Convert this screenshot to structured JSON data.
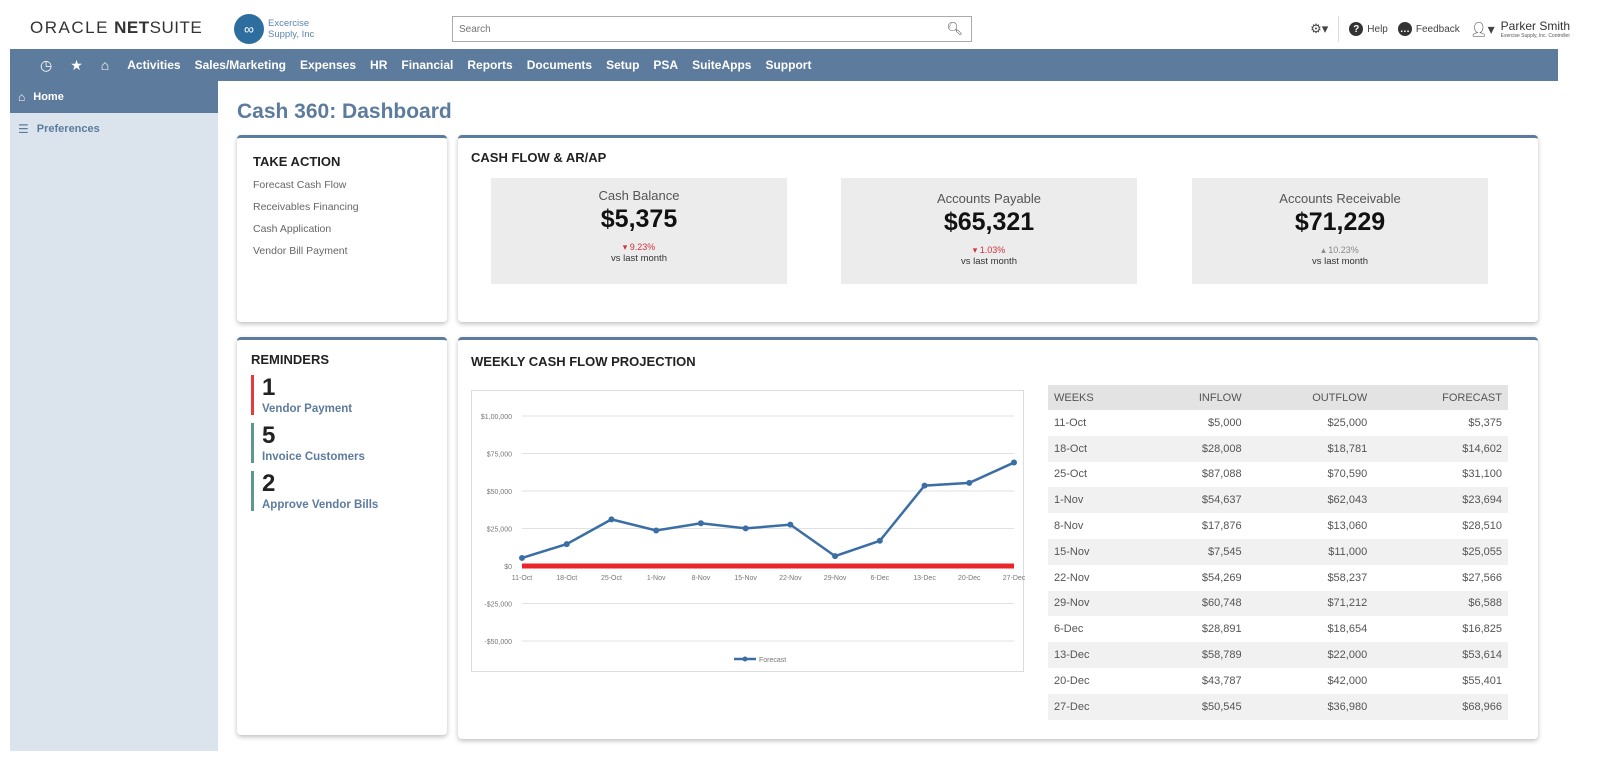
{
  "header": {
    "logo_oracle": "ORACLE",
    "logo_netsuite_bold": "NET",
    "logo_netsuite_light": "SUITE",
    "company_line1": "Excercise",
    "company_line2": "Supply, Inc",
    "search_placeholder": "Search",
    "help_label": "Help",
    "feedback_label": "Feedback",
    "user_name": "Parker Smith",
    "user_role": "Exercise Supply, Inc. Controller"
  },
  "nav": {
    "items": [
      "Activities",
      "Sales/Marketing",
      "Expenses",
      "HR",
      "Financial",
      "Reports",
      "Documents",
      "Setup",
      "PSA",
      "SuiteApps",
      "Support"
    ]
  },
  "sidebar": {
    "items": [
      {
        "label": "Home",
        "icon": "home-icon",
        "active": true
      },
      {
        "label": "Preferences",
        "icon": "sliders-icon",
        "active": false
      }
    ]
  },
  "page": {
    "title": "Cash 360: Dashboard"
  },
  "take_action": {
    "title": "TAKE ACTION",
    "links": [
      "Forecast Cash Flow",
      "Receivables Financing",
      "Cash Application",
      "Vendor Bill Payment"
    ]
  },
  "cashflow": {
    "title": "CASH FLOW & AR/AP",
    "kpis": [
      {
        "label": "Cash Balance",
        "value": "$5,375",
        "change": "9.23%",
        "direction": "down",
        "sub": "vs last month"
      },
      {
        "label": "Accounts Payable",
        "value": "$65,321",
        "change": "1.03%",
        "direction": "down",
        "sub": "vs last month"
      },
      {
        "label": "Accounts Receivable",
        "value": "$71,229",
        "change": "10.23%",
        "direction": "up",
        "sub": "vs last month"
      }
    ]
  },
  "reminders": {
    "title": "REMINDERS",
    "items": [
      {
        "count": "1",
        "label": "Vendor Payment",
        "color": "#e33b3f"
      },
      {
        "count": "5",
        "label": "Invoice Customers",
        "color": "#5a9a8a"
      },
      {
        "count": "2",
        "label": "Approve Vendor Bills",
        "color": "#5a9a8a"
      }
    ]
  },
  "weekly": {
    "title": "WEEKLY CASH FLOW PROJECTION",
    "table": {
      "headers": [
        "WEEKS",
        "INFLOW",
        "OUTFLOW",
        "FORECAST"
      ],
      "rows": [
        [
          "11-Oct",
          "$5,000",
          "$25,000",
          "$5,375"
        ],
        [
          "18-Oct",
          "$28,008",
          "$18,781",
          "$14,602"
        ],
        [
          "25-Oct",
          "$87,088",
          "$70,590",
          "$31,100"
        ],
        [
          "1-Nov",
          "$54,637",
          "$62,043",
          "$23,694"
        ],
        [
          "8-Nov",
          "$17,876",
          "$13,060",
          "$28,510"
        ],
        [
          "15-Nov",
          "$7,545",
          "$11,000",
          "$25,055"
        ],
        [
          "22-Nov",
          "$54,269",
          "$58,237",
          "$27,566"
        ],
        [
          "29-Nov",
          "$60,748",
          "$71,212",
          "$6,588"
        ],
        [
          "6-Dec",
          "$28,891",
          "$18,654",
          "$16,825"
        ],
        [
          "13-Dec",
          "$58,789",
          "$22,000",
          "$53,614"
        ],
        [
          "20-Dec",
          "$43,787",
          "$42,000",
          "$55,401"
        ],
        [
          "27-Dec",
          "$50,545",
          "$36,980",
          "$68,966"
        ]
      ]
    }
  },
  "chart_data": {
    "type": "line",
    "title": "",
    "categories": [
      "11-Oct",
      "18-Oct",
      "25-Oct",
      "1-Nov",
      "8-Nov",
      "15-Nov",
      "22-Nov",
      "29-Nov",
      "6-Dec",
      "13-Dec",
      "20-Dec",
      "27-Dec"
    ],
    "series": [
      {
        "name": "Forecast",
        "color": "#3a6ea5",
        "values": [
          5375,
          14602,
          31100,
          23694,
          28510,
          25055,
          27566,
          6588,
          16825,
          53614,
          55401,
          68966
        ]
      }
    ],
    "zero_line_color": "#e8262b",
    "yticks": [
      100000,
      75000,
      50000,
      25000,
      0,
      -25000,
      -50000
    ],
    "ytick_labels": [
      "$1,00,000",
      "$75,000",
      "$50,000",
      "$25,000",
      "$0",
      "-$25,000",
      "-$50,000"
    ],
    "ylim": [
      -50000,
      100000
    ],
    "grid": true,
    "legend": "bottom",
    "xlabel": "",
    "ylabel": ""
  }
}
